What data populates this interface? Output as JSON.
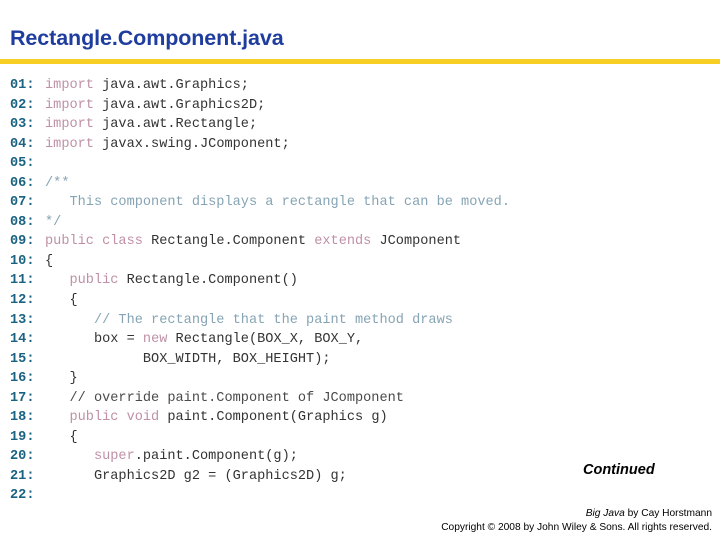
{
  "slide": {
    "title": "Rectangle.Component.java",
    "continued_label": "Continued"
  },
  "code": {
    "lines": [
      {
        "no": "01:",
        "segments": [
          {
            "t": "kw",
            "s": "import"
          },
          {
            "t": "code",
            "s": " java.awt.Graphics;"
          }
        ]
      },
      {
        "no": "02:",
        "segments": [
          {
            "t": "kw",
            "s": "import"
          },
          {
            "t": "code",
            "s": " java.awt.Graphics2D;"
          }
        ]
      },
      {
        "no": "03:",
        "segments": [
          {
            "t": "kw",
            "s": "import"
          },
          {
            "t": "code",
            "s": " java.awt.Rectangle;"
          }
        ]
      },
      {
        "no": "04:",
        "segments": [
          {
            "t": "kw",
            "s": "import"
          },
          {
            "t": "code",
            "s": " javax.swing.JComponent;"
          }
        ]
      },
      {
        "no": "05:",
        "segments": [
          {
            "t": "code",
            "s": ""
          }
        ]
      },
      {
        "no": "06:",
        "segments": [
          {
            "t": "cmt",
            "s": "/**"
          }
        ]
      },
      {
        "no": "07:",
        "segments": [
          {
            "t": "cmt",
            "s": "   This component displays a rectangle that can be moved."
          }
        ]
      },
      {
        "no": "08:",
        "segments": [
          {
            "t": "cmt",
            "s": "*/"
          }
        ]
      },
      {
        "no": "09:",
        "segments": [
          {
            "t": "kw",
            "s": "public class"
          },
          {
            "t": "code",
            "s": " Rectangle.Component "
          },
          {
            "t": "kw",
            "s": "extends"
          },
          {
            "t": "code",
            "s": " JComponent"
          }
        ]
      },
      {
        "no": "10:",
        "segments": [
          {
            "t": "code",
            "s": "{"
          }
        ]
      },
      {
        "no": "11:",
        "segments": [
          {
            "t": "kw",
            "s": "   public"
          },
          {
            "t": "code",
            "s": " Rectangle.Component()"
          }
        ]
      },
      {
        "no": "12:",
        "segments": [
          {
            "t": "code",
            "s": "   {"
          }
        ]
      },
      {
        "no": "13:",
        "segments": [
          {
            "t": "cmt",
            "s": "      // The rectangle that the paint method draws"
          }
        ]
      },
      {
        "no": "14:",
        "segments": [
          {
            "t": "code",
            "s": "      box = "
          },
          {
            "t": "kw",
            "s": "new"
          },
          {
            "t": "code",
            "s": " Rectangle(BOX_X, BOX_Y,"
          }
        ]
      },
      {
        "no": "15:",
        "segments": [
          {
            "t": "code",
            "s": "            BOX_WIDTH, BOX_HEIGHT);"
          }
        ]
      },
      {
        "no": "16:",
        "segments": [
          {
            "t": "code",
            "s": "   }"
          }
        ]
      },
      {
        "no": "17:",
        "segments": [
          {
            "t": "cmt2",
            "s": "   // override paint.Component of JComponent"
          }
        ]
      },
      {
        "no": "18:",
        "segments": [
          {
            "t": "kw",
            "s": "   public void"
          },
          {
            "t": "code",
            "s": " paint.Component(Graphics g)"
          }
        ]
      },
      {
        "no": "19:",
        "segments": [
          {
            "t": "code",
            "s": "   {"
          }
        ]
      },
      {
        "no": "20:",
        "segments": [
          {
            "t": "kw",
            "s": "      super"
          },
          {
            "t": "code",
            "s": ".paint.Component(g);"
          }
        ]
      },
      {
        "no": "21:",
        "segments": [
          {
            "t": "code",
            "s": "      Graphics2D g2 = (Graphics2D) g;"
          }
        ]
      },
      {
        "no": "22:",
        "segments": [
          {
            "t": "code",
            "s": ""
          }
        ]
      }
    ]
  },
  "footer": {
    "book_title": "Big Java",
    "byline": " by  Cay Horstmann",
    "copyright": "Copyright © 2008 by John Wiley & Sons.  All rights reserved."
  }
}
